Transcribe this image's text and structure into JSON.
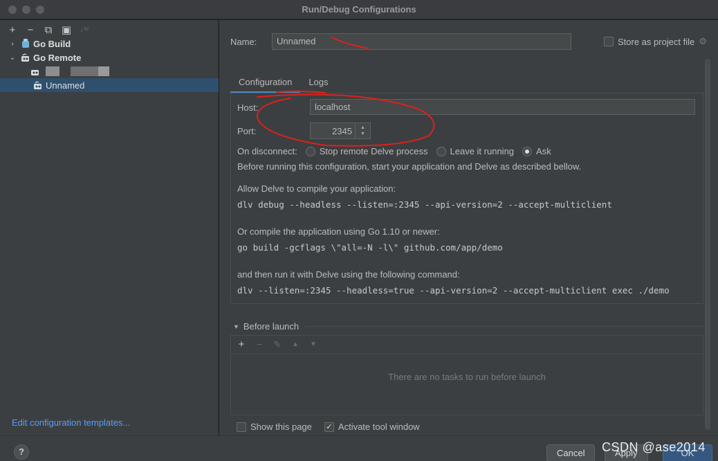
{
  "window": {
    "title": "Run/Debug Configurations"
  },
  "left": {
    "toolbar": [
      "+",
      "−",
      "⧉",
      "▣",
      "↓ᵃᶻ"
    ],
    "tree": [
      {
        "label": "Go Build",
        "icon": "go-build-icon",
        "bold": true,
        "expand": "›"
      },
      {
        "label": "Go Remote",
        "icon": "go-remote-icon",
        "bold": true,
        "expand": "⌄"
      },
      {
        "label": "Unnamed",
        "icon": "go-remote-icon",
        "selected": true
      }
    ],
    "edit_templates": "Edit configuration templates..."
  },
  "name": {
    "label": "Name:",
    "value": "Unnamed"
  },
  "store": {
    "label": "Store as project file",
    "checked": false
  },
  "tabs": [
    {
      "label": "Configuration",
      "active": true
    },
    {
      "label": "Logs",
      "active": false
    }
  ],
  "config": {
    "host_label": "Host:",
    "host_value": "localhost",
    "port_label": "Port:",
    "port_value": "2345",
    "disconnect_label": "On disconnect:",
    "disconnect_options": [
      {
        "label": "Stop remote Delve process",
        "selected": false
      },
      {
        "label": "Leave it running",
        "selected": false
      },
      {
        "label": "Ask",
        "selected": true
      }
    ],
    "info": "Before running this configuration, start your application and Delve as described bellow.",
    "allow_text": "Allow Delve to compile your application:",
    "cmd1": "dlv debug --headless --listen=:2345 --api-version=2 --accept-multiclient",
    "or_text": "Or compile the application using Go 1.10 or newer:",
    "cmd2": "go build -gcflags \\\"all=-N -l\\\" github.com/app/demo",
    "then_text": "and then run it with Delve using the following command:",
    "cmd3": "dlv --listen=:2345 --headless=true --api-version=2 --accept-multiclient exec ./demo"
  },
  "before_launch": {
    "title": "Before launch",
    "empty": "There are no tasks to run before launch",
    "tools": [
      "+",
      "−",
      "✎",
      "▲",
      "▼"
    ]
  },
  "bottom": {
    "show_page": {
      "label": "Show this page",
      "checked": false
    },
    "activate": {
      "label": "Activate tool window",
      "checked": true
    }
  },
  "footer": {
    "help": "?",
    "cancel": "Cancel",
    "apply": "Apply",
    "ok": "OK"
  },
  "watermark": "CSDN @ase2014",
  "colors": {
    "accent": "#4a88c7",
    "link": "#589df6",
    "selection": "#2f4f6e",
    "annotation": "#e0201a"
  }
}
